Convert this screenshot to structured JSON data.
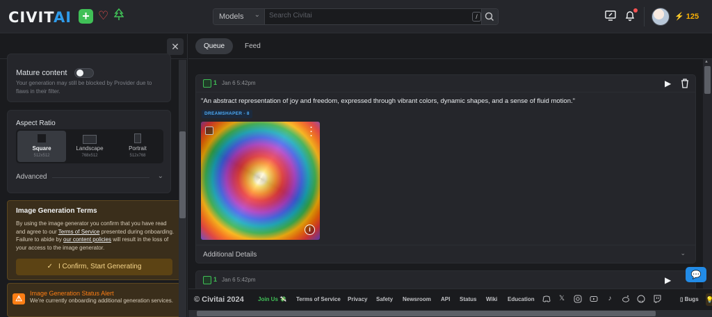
{
  "header": {
    "logo_left": "CIVIT",
    "logo_right": "AI",
    "search": {
      "selected_type": "Models",
      "placeholder": "Search Civitai",
      "shortcut": "/"
    },
    "buzz_amount": "125",
    "accent_color": "#2f9bea"
  },
  "left_panel": {
    "mature": {
      "label": "Mature content",
      "description": "Your generation may still be blocked by Provider due to flaws in their filter.",
      "enabled": false
    },
    "aspect_ratio": {
      "title": "Aspect Ratio",
      "options": [
        {
          "name": "Square",
          "size": "512x512",
          "selected": true
        },
        {
          "name": "Landscape",
          "size": "768x512",
          "selected": false
        },
        {
          "name": "Portrait",
          "size": "512x768",
          "selected": false
        }
      ],
      "advanced_label": "Advanced"
    },
    "terms": {
      "title": "Image Generation Terms",
      "text_1": "By using the image generator you confirm that you have read and agree to our ",
      "tos_link": "Terms of Service",
      "text_2": " presented during onboarding. Failure to abide by ",
      "policies_link": "our content policies",
      "text_3": " will result in the loss of your access to the image generator.",
      "button": "I Confirm, Start Generating"
    },
    "alert": {
      "title": "Image Generation Status Alert",
      "text": "We're currently onboarding additional generation services."
    }
  },
  "main": {
    "tabs": [
      {
        "label": "Queue",
        "active": true
      },
      {
        "label": "Feed",
        "active": false
      }
    ],
    "generations": [
      {
        "count": "1",
        "time": "Jan 6 5:42pm",
        "prompt": "\"An abstract representation of joy and freedom, expressed through vibrant colors, dynamic shapes, and a sense of fluid motion.\"",
        "model": "DREAMSHAPER - 8",
        "details_label": "Additional Details"
      },
      {
        "count": "1",
        "time": "Jan 6 5:42pm"
      }
    ]
  },
  "footer": {
    "copyright": "© Civitai 2024",
    "join": "Join Us 💸",
    "links": [
      "Terms of Service",
      "Privacy",
      "Safety",
      "Newsroom",
      "API",
      "Status",
      "Wiki",
      "Education"
    ],
    "social_icons": [
      "discord-icon",
      "x-icon",
      "instagram-icon",
      "youtube-icon",
      "tiktok-icon",
      "reddit-icon",
      "github-icon",
      "twitch-icon"
    ],
    "bugs": "Bugs",
    "bugs_glyph": "▯",
    "ideas_glyph": "💡"
  }
}
